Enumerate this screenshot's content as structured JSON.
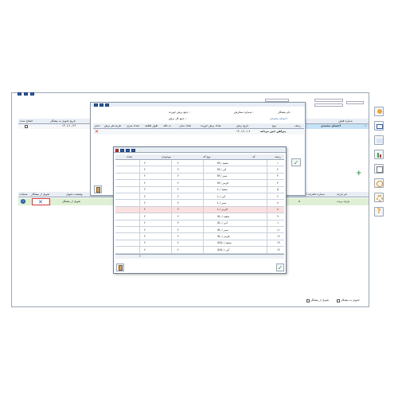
{
  "main": {
    "tabs": [
      "",
      "",
      ""
    ],
    "filter_fields": [
      "",
      "",
      "",
      ""
    ],
    "left_table": {
      "headers": [
        "اصلاح شده",
        "تاریخ تحویل به بیشکار"
      ],
      "row": {
        "date": "۱۴۰۱/۱۰/۱۴"
      }
    },
    "right_table": {
      "headers": [
        "شماره قبض"
      ],
      "row": {
        "no": "۱",
        "name": "احسان محمدی"
      }
    },
    "lower_table": {
      "headers": [
        "عملیات",
        "تحویل از بیشکار",
        "وضعیت تحویل",
        "",
        "",
        "شماره دفترچه / حساب بیشکار",
        "نام پارچه"
      ],
      "row": {
        "status": "تحویل از بیشکار",
        "count": "۵",
        "fabric": "پارچه برنت"
      }
    },
    "bottom_options": [
      "تحویل از بیشکار",
      "تحویل به بیشکار"
    ]
  },
  "middle_window": {
    "fields": [
      "جمع برش خورده :",
      "جمع کل برش :",
      "شماره سفارش :",
      "نام بیشکار :"
    ],
    "field_values": [
      "",
      "",
      "",
      "احسان محمدی"
    ],
    "headers": [
      "ردیف",
      "نوع",
      "تاریخ برش",
      "تعداد برش خورده",
      "تعداد سایز",
      "ته تاقه",
      "طول قطعه",
      "تعداد متری",
      "هزینه هر برش",
      "حذف"
    ],
    "row": {
      "name": "پیراهن جین مردانه",
      "date": "۱۴۰۱/۱۰/۰۷"
    }
  },
  "size_dialog": {
    "headers": [
      "ردیف",
      "کد",
      "نوع کد",
      "موجودی",
      "تعداد"
    ],
    "rows": [
      {
        "no": "۱",
        "code": "M / سفید",
        "qty": "۲",
        "avail": "۲"
      },
      {
        "no": "۲",
        "code": "M / آبی",
        "qty": "۲",
        "avail": "۲"
      },
      {
        "no": "۳",
        "code": "M / سبز",
        "qty": "۲",
        "avail": "۲"
      },
      {
        "no": "۴",
        "code": "M / قرمز",
        "qty": "۲",
        "avail": "۲"
      },
      {
        "no": "۵",
        "code": "L / سفید",
        "qty": "۲",
        "avail": "۲"
      },
      {
        "no": "۶",
        "code": "L / آبی",
        "qty": "۲",
        "avail": "۲"
      },
      {
        "no": "۷",
        "code": "L / سبز",
        "qty": "۲",
        "avail": "۲"
      },
      {
        "no": "۸",
        "code": "L / قرمز",
        "qty": "۲",
        "avail": "۲"
      },
      {
        "no": "۹",
        "code": "XL / سفید",
        "qty": "۲",
        "avail": "۲"
      },
      {
        "no": "۱۰",
        "code": "XL / آبی",
        "qty": "۲",
        "avail": "۲"
      },
      {
        "no": "۱۱",
        "code": "XL / سبز",
        "qty": "۲",
        "avail": "۲"
      },
      {
        "no": "۱۲",
        "code": "XL / قرمز",
        "qty": "۲",
        "avail": "۲"
      },
      {
        "no": "۱۳",
        "code": "XXL / سفید",
        "qty": "۲",
        "avail": "۲"
      },
      {
        "no": "۱۴",
        "code": "XXL / آبی",
        "qty": "۲",
        "avail": "۲"
      }
    ],
    "total": "۲"
  },
  "colors": {
    "accent": "#2d5fa8",
    "close": "#c8362b",
    "selected_row": "#c6e2f7",
    "highlight_row": "#fbe0e0",
    "green_row": "#dff0d4",
    "confirm": "#3aa04a"
  }
}
